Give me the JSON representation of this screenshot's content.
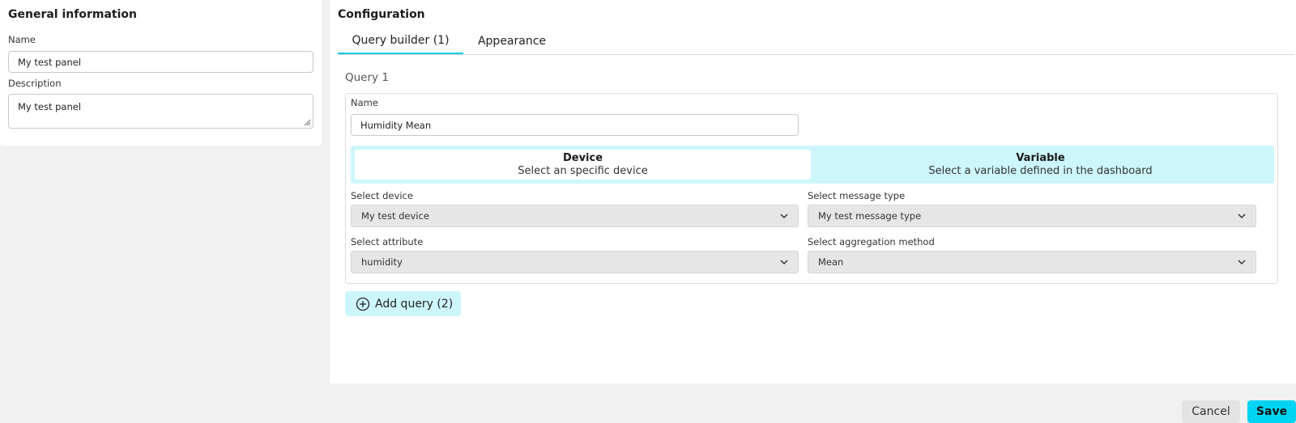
{
  "general": {
    "title": "General information",
    "name_label": "Name",
    "name_value": "My test panel",
    "description_label": "Description",
    "description_value": "My test panel"
  },
  "config": {
    "title": "Configuration",
    "tabs": [
      {
        "label": "Query builder (1)",
        "active": true
      },
      {
        "label": "Appearance",
        "active": false
      }
    ],
    "query": {
      "title": "Query 1",
      "name_label": "Name",
      "name_value": "Humidity Mean",
      "source_options": [
        {
          "title": "Device",
          "subtitle": "Select an specific device",
          "selected": true
        },
        {
          "title": "Variable",
          "subtitle": "Select a variable defined in the dashboard",
          "selected": false
        }
      ],
      "device_label": "Select device",
      "device_value": "My test device",
      "message_type_label": "Select message type",
      "message_type_value": "My test message type",
      "attribute_label": "Select attribute",
      "attribute_value": "humidity",
      "aggregation_label": "Select aggregation method",
      "aggregation_value": "Mean"
    },
    "add_query_label": "Add query (2)"
  },
  "footer": {
    "cancel_label": "Cancel",
    "save_label": "Save"
  },
  "colors": {
    "accent": "#00d4f2",
    "accent_light": "#cdf6fc",
    "background": "#f1f1f1"
  },
  "icons": {
    "add_query": "plus-circle-icon",
    "select": "chevron-down-icon",
    "textarea": "resize-grip-icon"
  }
}
